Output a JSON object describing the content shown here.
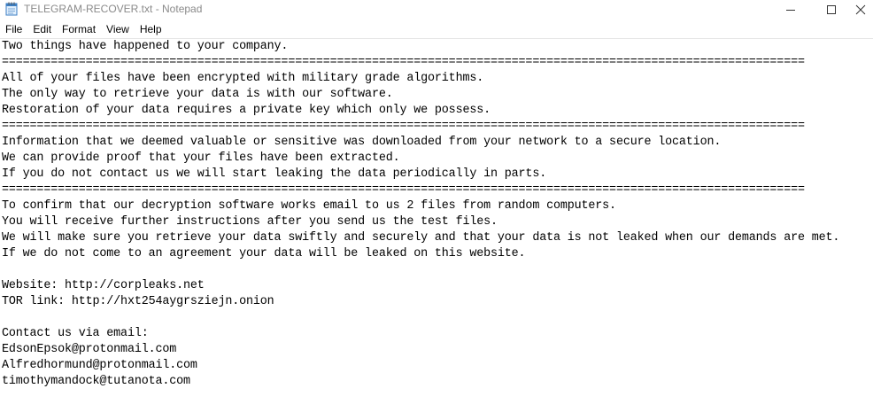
{
  "window": {
    "title": "TELEGRAM-RECOVER.txt - Notepad",
    "icon": "notepad-icon"
  },
  "menu": {
    "items": [
      "File",
      "Edit",
      "Format",
      "View",
      "Help"
    ]
  },
  "document": {
    "lines": [
      "Two things have happened to your company.",
      "===================================================================================================================",
      "All of your files have been encrypted with military grade algorithms.",
      "The only way to retrieve your data is with our software.",
      "Restoration of your data requires a private key which only we possess.",
      "===================================================================================================================",
      "Information that we deemed valuable or sensitive was downloaded from your network to a secure location.",
      "We can provide proof that your files have been extracted.",
      "If you do not contact us we will start leaking the data periodically in parts.",
      "===================================================================================================================",
      "To confirm that our decryption software works email to us 2 files from random computers.",
      "You will receive further instructions after you send us the test files.",
      "We will make sure you retrieve your data swiftly and securely and that your data is not leaked when our demands are met.",
      "If we do not come to an agreement your data will be leaked on this website.",
      "",
      "Website: http://corpleaks.net",
      "TOR link: http://hxt254aygrsziejn.onion",
      "",
      "Contact us via email:",
      "EdsonEpsok@protonmail.com",
      "Alfredhormund@protonmail.com",
      "timothymandock@tutanota.com"
    ]
  }
}
